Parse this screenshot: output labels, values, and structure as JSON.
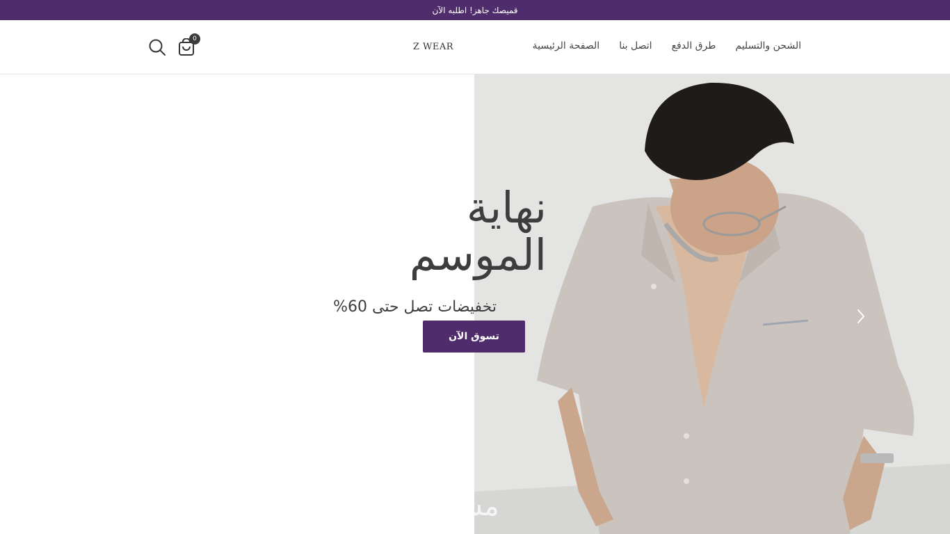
{
  "announcement": {
    "text": "قميصك جاهز! اطلبه الآن"
  },
  "header": {
    "nav": [
      {
        "label": "الصفحة الرئيسية"
      },
      {
        "label": "اتصل بنا"
      },
      {
        "label": "طرق الدفع"
      },
      {
        "label": "الشحن والتسليم"
      }
    ],
    "logo": "Z WEAR",
    "cart_count": "0",
    "icons": {
      "search": "search-icon",
      "cart": "shopping-bag-icon"
    }
  },
  "hero": {
    "title_line1": "نهاية",
    "title_line2": "الموسم",
    "subtitle": "تخفيضات تصل حتى 60%",
    "cta_label": "تسوق الآن",
    "next_icon": "chevron-right-icon",
    "watermark": "مستقل"
  },
  "colors": {
    "brand": "#4f2d6c",
    "text": "#3d3d3d",
    "background": "#ffffff"
  }
}
